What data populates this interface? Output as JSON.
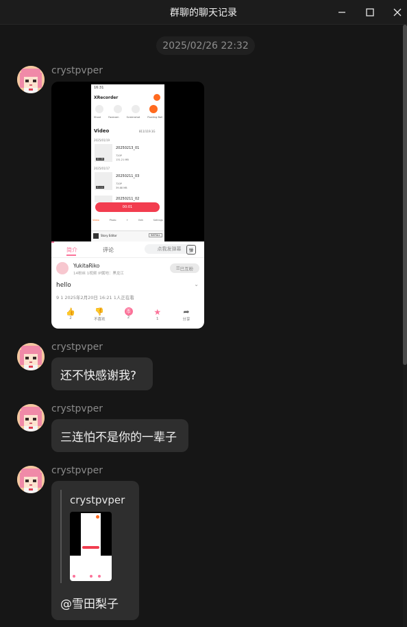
{
  "window": {
    "title": "群聊的聊天记录",
    "controls": [
      "minimize-icon",
      "maximize-icon",
      "close-icon"
    ]
  },
  "timestamp": "2025/02/26 22:32",
  "messages": [
    {
      "sender": "crystpvper",
      "type": "image",
      "screenshot": {
        "status_time": "16:31",
        "app_name": "XRecorder",
        "tools": [
          "Shoot",
          "Facecam",
          "Screenshot",
          "Floating Ball"
        ],
        "section": "Video",
        "storage": "811/119.1G",
        "date_1": "2025/01/19",
        "item_1_name": "20250213_01",
        "item_1_res": "720P",
        "item_1_size": "131.21 MB",
        "item_1_dur": "00:39",
        "date_2": "2025/01/17",
        "item_2_name": "20250211_03",
        "item_2_res": "720P",
        "item_2_size": "39.88 MB",
        "item_2_dur": "01:12",
        "item_3_name": "20250211_02",
        "record_time": "00:01",
        "nav": [
          "Video",
          "Photo",
          "Edit",
          "Settings"
        ],
        "ad_title": "Story Editor",
        "ad_install": "INSTALL"
      },
      "video_info": {
        "tab_intro": "简介",
        "tab_comment": "评论",
        "danmaku_placeholder": "点我发弹幕",
        "danmaku_toggle": "弹",
        "uploader": "YukitaRiko",
        "uploader_stats": "14粉丝  1视频  IP属地：黑龙江",
        "follow_label": "已互粉",
        "video_title": "hello",
        "meta": "9  1  2025年2月20日 16:21  1人正在看",
        "actions": [
          {
            "icon": "thumb-up-icon",
            "label": "2"
          },
          {
            "icon": "thumb-down-icon",
            "label": "不喜欢"
          },
          {
            "icon": "coin-icon",
            "label": "2"
          },
          {
            "icon": "star-icon",
            "label": "1"
          },
          {
            "icon": "share-icon",
            "label": "分享"
          }
        ]
      }
    },
    {
      "sender": "crystpvper",
      "type": "text",
      "text": "还不快感谢我?"
    },
    {
      "sender": "crystpvper",
      "type": "text",
      "text": "三连怕不是你的一辈子"
    },
    {
      "sender": "crystpvper",
      "type": "quote",
      "quote_sender": "crystpvper",
      "text": "@雪田梨子"
    }
  ],
  "colors": {
    "background": "#161616",
    "bubble": "#2e2e2e",
    "accent_red": "#f23d4f",
    "accent_pink": "#fb7299",
    "accent_orange": "#ff6a1f"
  }
}
